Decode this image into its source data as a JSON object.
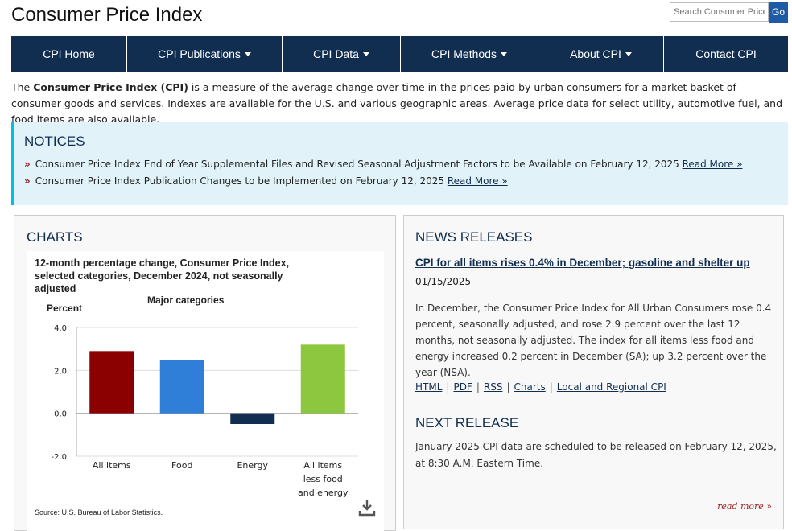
{
  "header": {
    "title": "Consumer Price Index",
    "search_placeholder": "Search Consumer Price",
    "search_button": "Go"
  },
  "nav": {
    "items": [
      {
        "label": "CPI Home",
        "dropdown": false
      },
      {
        "label": "CPI Publications",
        "dropdown": true
      },
      {
        "label": "CPI Data",
        "dropdown": true
      },
      {
        "label": "CPI Methods",
        "dropdown": true
      },
      {
        "label": "About CPI",
        "dropdown": true
      },
      {
        "label": "Contact CPI",
        "dropdown": false
      }
    ]
  },
  "intro": {
    "lead": "The ",
    "bold": "Consumer Price Index (CPI)",
    "rest": " is a measure of the average change over time in the prices paid by urban consumers for a market basket of consumer goods and services. Indexes are available for the U.S. and various geographic areas. Average price data for select utility, automotive fuel, and food items are also available."
  },
  "notices": {
    "title": "NOTICES",
    "items": [
      {
        "text": "Consumer Price Index End of Year Supplemental Files and Revised Seasonal Adjustment Factors to be Available on February 12, 2025 ",
        "link": "Read More »"
      },
      {
        "text": "Consumer Price Index Publication Changes to be Implemented on February 12, 2025 ",
        "link": "Read More »"
      }
    ]
  },
  "charts": {
    "title": "CHARTS",
    "heading": "12-month percentage change, Consumer Price Index, selected categories, December 2024, not seasonally adjusted",
    "source": "Source: U.S. Bureau of Labor Statistics."
  },
  "chart_data": {
    "type": "bar",
    "title": "12-month percentage change, Consumer Price Index, selected categories, December 2024, not seasonally adjusted",
    "subtitle": "Major categories",
    "ylabel": "Percent",
    "xlabel": "",
    "categories": [
      "All items",
      "Food",
      "Energy",
      "All items less food and energy"
    ],
    "category_lines": [
      [
        "All items"
      ],
      [
        "Food"
      ],
      [
        "Energy"
      ],
      [
        "All items",
        "less food",
        "and energy"
      ]
    ],
    "values": [
      2.9,
      2.5,
      -0.5,
      3.2
    ],
    "colors": [
      "#8b0000",
      "#2f7fd8",
      "#112e51",
      "#8dc63f"
    ],
    "ylim": [
      -2.0,
      4.0
    ],
    "yticks": [
      "4.0",
      "2.0",
      "0.0",
      "-2.0"
    ],
    "ytick_values": [
      4.0,
      2.0,
      0.0,
      -2.0
    ],
    "grid": true,
    "legend": "none"
  },
  "news": {
    "title": "NEWS RELEASES",
    "headline": "CPI for all items rises 0.4% in December; gasoline and shelter up",
    "date": "01/15/2025",
    "body": "In December, the Consumer Price Index for All Urban Consumers rose 0.4 percent, seasonally adjusted, and rose 2.9 percent over the last 12 months, not seasonally adjusted. The index for all items less food and energy increased 0.2 percent in December (SA); up 3.2 percent over the year (NSA).",
    "links": [
      "HTML",
      "PDF",
      "RSS",
      "Charts",
      "Local and Regional CPI"
    ],
    "next_title": "NEXT RELEASE",
    "next_body": "January 2025 CPI data are scheduled to be released on February 12, 2025, at 8:30 A.M. Eastern Time.",
    "read_more": "read more »"
  }
}
